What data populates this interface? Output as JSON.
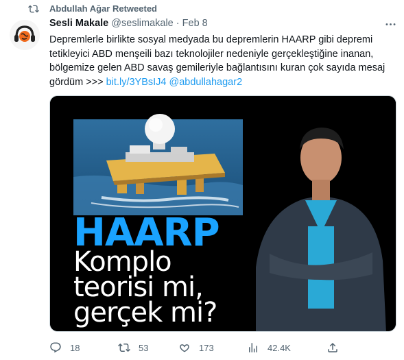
{
  "retweet_banner": {
    "text": "Abdullah Ağar Retweeted",
    "icon": "retweet-icon"
  },
  "tweet": {
    "author_name": "Sesli Makale",
    "author_handle": "@seslimakale",
    "separator": "·",
    "date": "Feb 8",
    "text_before_link": "Depremlerle birlikte sosyal medyada bu depremlerin HAARP gibi depremi tetikleyici ABD menşeili bazı teknolojiler nedeniyle gerçekleştiğine inanan, bölgemize gelen ABD savaş gemileriyle bağlantısını kuran çok sayıda mesaj gördüm >>> ",
    "link": "bit.ly/3YBsIJ4",
    "mention": "@abdullahagar2"
  },
  "media": {
    "headline": "HAARP",
    "subtitle_lines": [
      "Komplo",
      "teorisi mi,",
      "gerçek mi?"
    ],
    "colors": {
      "headline": "#1aa3ff",
      "background": "#000000",
      "sea": "#2a6a9a"
    }
  },
  "actions": {
    "replies": "18",
    "retweets": "53",
    "likes": "173",
    "views": "42.4K"
  },
  "colors": {
    "accent": "#1d9bf0",
    "muted": "#536471",
    "text": "#0f1419"
  }
}
